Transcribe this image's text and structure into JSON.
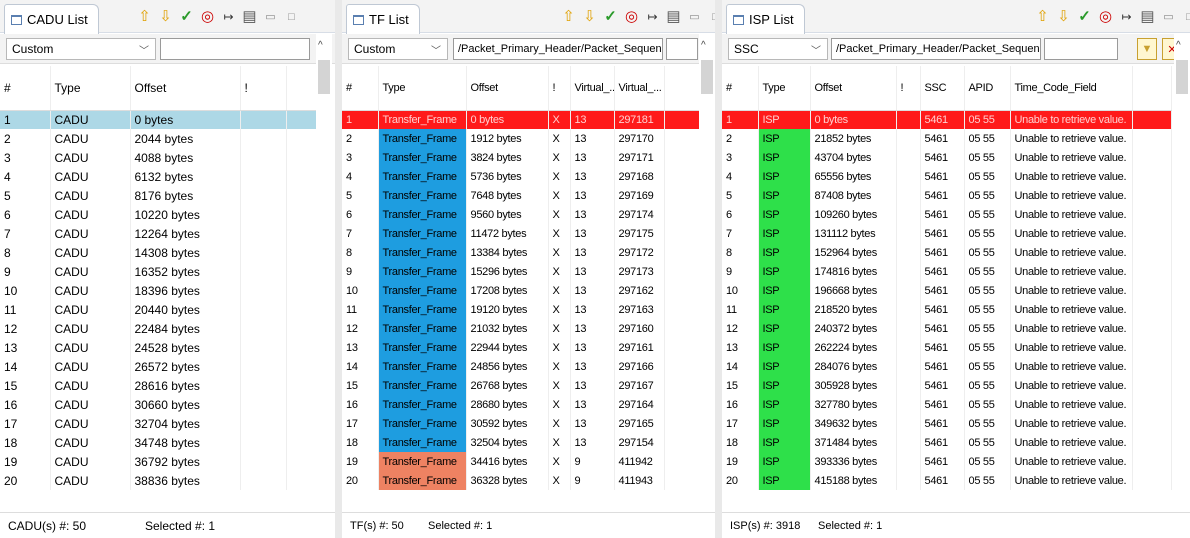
{
  "cadu": {
    "title": "CADU List",
    "filter": "Custom",
    "filter_text": "",
    "headers": [
      "#",
      "Type",
      "Offset",
      "!"
    ],
    "rows": [
      [
        "1",
        "CADU",
        "0 bytes",
        ""
      ],
      [
        "2",
        "CADU",
        "2044 bytes",
        ""
      ],
      [
        "3",
        "CADU",
        "4088 bytes",
        ""
      ],
      [
        "4",
        "CADU",
        "6132 bytes",
        ""
      ],
      [
        "5",
        "CADU",
        "8176 bytes",
        ""
      ],
      [
        "6",
        "CADU",
        "10220 bytes",
        ""
      ],
      [
        "7",
        "CADU",
        "12264 bytes",
        ""
      ],
      [
        "8",
        "CADU",
        "14308 bytes",
        ""
      ],
      [
        "9",
        "CADU",
        "16352 bytes",
        ""
      ],
      [
        "10",
        "CADU",
        "18396 bytes",
        ""
      ],
      [
        "11",
        "CADU",
        "20440 bytes",
        ""
      ],
      [
        "12",
        "CADU",
        "22484 bytes",
        ""
      ],
      [
        "13",
        "CADU",
        "24528 bytes",
        ""
      ],
      [
        "14",
        "CADU",
        "26572 bytes",
        ""
      ],
      [
        "15",
        "CADU",
        "28616 bytes",
        ""
      ],
      [
        "16",
        "CADU",
        "30660 bytes",
        ""
      ],
      [
        "17",
        "CADU",
        "32704 bytes",
        ""
      ],
      [
        "18",
        "CADU",
        "34748 bytes",
        ""
      ],
      [
        "19",
        "CADU",
        "36792 bytes",
        ""
      ],
      [
        "20",
        "CADU",
        "38836 bytes",
        ""
      ]
    ],
    "count": "CADU(s) #: 50",
    "selected": "Selected #: 1"
  },
  "tf": {
    "title": "TF List",
    "filter": "Custom",
    "filter_text": "/Packet_Primary_Header/Packet_Sequence_Ctrl/",
    "headers": [
      "#",
      "Type",
      "Offset",
      "!",
      "Virtual_...",
      "Virtual_..."
    ],
    "rows": [
      [
        "1",
        "Transfer_Frame",
        "0 bytes",
        "X",
        "13",
        "297181",
        "red"
      ],
      [
        "2",
        "Transfer_Frame",
        "1912 bytes",
        "X",
        "13",
        "297170",
        "blue"
      ],
      [
        "3",
        "Transfer_Frame",
        "3824 bytes",
        "X",
        "13",
        "297171",
        "blue"
      ],
      [
        "4",
        "Transfer_Frame",
        "5736 bytes",
        "X",
        "13",
        "297168",
        "blue"
      ],
      [
        "5",
        "Transfer_Frame",
        "7648 bytes",
        "X",
        "13",
        "297169",
        "blue"
      ],
      [
        "6",
        "Transfer_Frame",
        "9560 bytes",
        "X",
        "13",
        "297174",
        "blue"
      ],
      [
        "7",
        "Transfer_Frame",
        "11472 bytes",
        "X",
        "13",
        "297175",
        "blue"
      ],
      [
        "8",
        "Transfer_Frame",
        "13384 bytes",
        "X",
        "13",
        "297172",
        "blue"
      ],
      [
        "9",
        "Transfer_Frame",
        "15296 bytes",
        "X",
        "13",
        "297173",
        "blue"
      ],
      [
        "10",
        "Transfer_Frame",
        "17208 bytes",
        "X",
        "13",
        "297162",
        "blue"
      ],
      [
        "11",
        "Transfer_Frame",
        "19120 bytes",
        "X",
        "13",
        "297163",
        "blue"
      ],
      [
        "12",
        "Transfer_Frame",
        "21032 bytes",
        "X",
        "13",
        "297160",
        "blue"
      ],
      [
        "13",
        "Transfer_Frame",
        "22944 bytes",
        "X",
        "13",
        "297161",
        "blue"
      ],
      [
        "14",
        "Transfer_Frame",
        "24856 bytes",
        "X",
        "13",
        "297166",
        "blue"
      ],
      [
        "15",
        "Transfer_Frame",
        "26768 bytes",
        "X",
        "13",
        "297167",
        "blue"
      ],
      [
        "16",
        "Transfer_Frame",
        "28680 bytes",
        "X",
        "13",
        "297164",
        "blue"
      ],
      [
        "17",
        "Transfer_Frame",
        "30592 bytes",
        "X",
        "13",
        "297165",
        "blue"
      ],
      [
        "18",
        "Transfer_Frame",
        "32504 bytes",
        "X",
        "13",
        "297154",
        "blue"
      ],
      [
        "19",
        "Transfer_Frame",
        "34416 bytes",
        "X",
        "9",
        "411942",
        "orange"
      ],
      [
        "20",
        "Transfer_Frame",
        "36328 bytes",
        "X",
        "9",
        "411943",
        "orange"
      ]
    ],
    "count": "TF(s) #: 50",
    "selected": "Selected #: 1"
  },
  "isp": {
    "title": "ISP List",
    "filter": "SSC",
    "filter_text": "/Packet_Primary_Header/Packet_Sequence_Ctrl/",
    "headers": [
      "#",
      "Type",
      "Offset",
      "!",
      "SSC",
      "APID",
      "Time_Code_Field"
    ],
    "rows": [
      [
        "1",
        "ISP",
        "0 bytes",
        "",
        "5461",
        "05 55",
        "Unable to retrieve value.",
        "red"
      ],
      [
        "2",
        "ISP",
        "21852 bytes",
        "",
        "5461",
        "05 55",
        "Unable to retrieve value.",
        "green"
      ],
      [
        "3",
        "ISP",
        "43704 bytes",
        "",
        "5461",
        "05 55",
        "Unable to retrieve value.",
        "green"
      ],
      [
        "4",
        "ISP",
        "65556 bytes",
        "",
        "5461",
        "05 55",
        "Unable to retrieve value.",
        "green"
      ],
      [
        "5",
        "ISP",
        "87408 bytes",
        "",
        "5461",
        "05 55",
        "Unable to retrieve value.",
        "green"
      ],
      [
        "6",
        "ISP",
        "109260 bytes",
        "",
        "5461",
        "05 55",
        "Unable to retrieve value.",
        "green"
      ],
      [
        "7",
        "ISP",
        "131112 bytes",
        "",
        "5461",
        "05 55",
        "Unable to retrieve value.",
        "green"
      ],
      [
        "8",
        "ISP",
        "152964 bytes",
        "",
        "5461",
        "05 55",
        "Unable to retrieve value.",
        "green"
      ],
      [
        "9",
        "ISP",
        "174816 bytes",
        "",
        "5461",
        "05 55",
        "Unable to retrieve value.",
        "green"
      ],
      [
        "10",
        "ISP",
        "196668 bytes",
        "",
        "5461",
        "05 55",
        "Unable to retrieve value.",
        "green"
      ],
      [
        "11",
        "ISP",
        "218520 bytes",
        "",
        "5461",
        "05 55",
        "Unable to retrieve value.",
        "green"
      ],
      [
        "12",
        "ISP",
        "240372 bytes",
        "",
        "5461",
        "05 55",
        "Unable to retrieve value.",
        "green"
      ],
      [
        "13",
        "ISP",
        "262224 bytes",
        "",
        "5461",
        "05 55",
        "Unable to retrieve value.",
        "green"
      ],
      [
        "14",
        "ISP",
        "284076 bytes",
        "",
        "5461",
        "05 55",
        "Unable to retrieve value.",
        "green"
      ],
      [
        "15",
        "ISP",
        "305928 bytes",
        "",
        "5461",
        "05 55",
        "Unable to retrieve value.",
        "green"
      ],
      [
        "16",
        "ISP",
        "327780 bytes",
        "",
        "5461",
        "05 55",
        "Unable to retrieve value.",
        "green"
      ],
      [
        "17",
        "ISP",
        "349632 bytes",
        "",
        "5461",
        "05 55",
        "Unable to retrieve value.",
        "green"
      ],
      [
        "18",
        "ISP",
        "371484 bytes",
        "",
        "5461",
        "05 55",
        "Unable to retrieve value.",
        "green"
      ],
      [
        "19",
        "ISP",
        "393336 bytes",
        "",
        "5461",
        "05 55",
        "Unable to retrieve value.",
        "green"
      ],
      [
        "20",
        "ISP",
        "415188 bytes",
        "",
        "5461",
        "05 55",
        "Unable to retrieve value.",
        "green"
      ]
    ],
    "count": "ISP(s) #: 3918",
    "selected": "Selected #: 1"
  },
  "toolbar_icons": [
    "arrow-up-icon",
    "arrow-down-icon",
    "checkmark-icon",
    "target-icon",
    "fit-columns-icon",
    "export-icon",
    "minimize-icon",
    "maximize-icon"
  ],
  "toolbar_glyphs": [
    "⇧",
    "⇩",
    "✓",
    "◎",
    "↦",
    "▤",
    "▭",
    "□"
  ],
  "colors": {
    "selected_row": "#add8e6",
    "error_row": "#ff1a1a",
    "tf_blue": "#1e9de0",
    "tf_orange": "#ee8262",
    "isp_green": "#2ee04a"
  }
}
